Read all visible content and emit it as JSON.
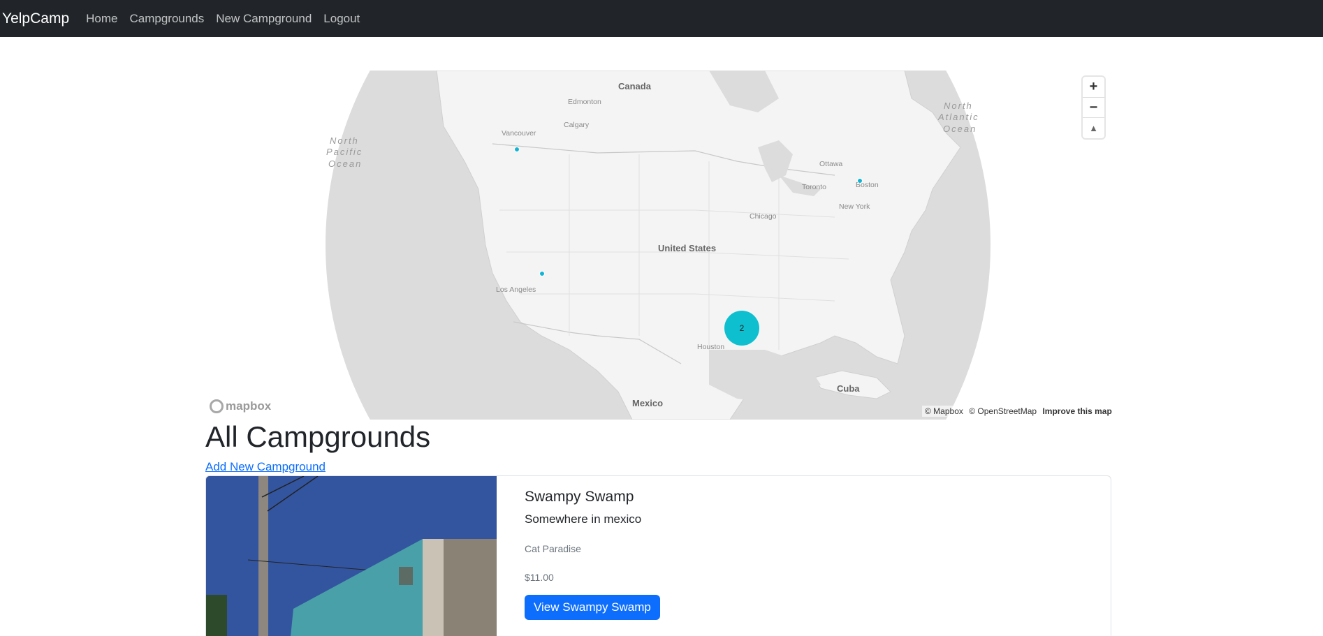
{
  "navbar": {
    "brand": "YelpCamp",
    "links": [
      "Home",
      "Campgrounds",
      "New Campground",
      "Logout"
    ]
  },
  "map": {
    "labels": {
      "canada": "Canada",
      "edmonton": "Edmonton",
      "calgary": "Calgary",
      "vancouver": "Vancouver",
      "north_pacific": [
        "North",
        "Pacific",
        "Ocean"
      ],
      "north_atlantic": [
        "North",
        "Atlantic",
        "Ocean"
      ],
      "ottawa": "Ottawa",
      "toronto": "Toronto",
      "boston": "Boston",
      "new_york": "New York",
      "chicago": "Chicago",
      "united_states": "United States",
      "los_angeles": "Los Angeles",
      "houston": "Houston",
      "mexico": "Mexico",
      "cuba": "Cuba"
    },
    "cluster_count": "2",
    "zoom_in": "+",
    "zoom_out": "−",
    "compass": "▲",
    "logo_text": "mapbox",
    "attribution_mapbox": "© Mapbox",
    "attribution_osm": "© OpenStreetMap",
    "improve": "Improve this map"
  },
  "page": {
    "title": "All Campgrounds",
    "add_link": "Add New Campground"
  },
  "campgrounds": [
    {
      "title": "Swampy Swamp",
      "location": "Somewhere in mexico",
      "description": "Cat Paradise",
      "price": "$11.00",
      "button": "View Swampy Swamp"
    }
  ],
  "colors": {
    "navbar": "#212529",
    "primary": "#0d6efd",
    "cluster": "#0ec0cf"
  }
}
